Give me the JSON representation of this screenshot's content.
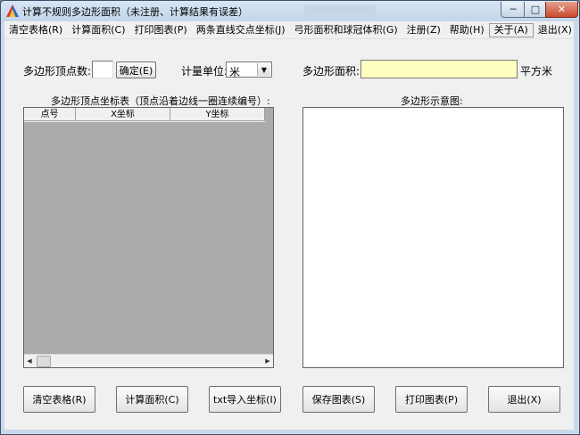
{
  "window": {
    "title": "计算不规则多边形面积（未注册、计算结果有误差）",
    "controls": {
      "minimize": "─",
      "maximize": "□",
      "close": "✕"
    }
  },
  "menu": [
    "清空表格(R)",
    "计算面积(C)",
    "打印图表(P)",
    "两条直线交点坐标(J)",
    "弓形面积和球冠体积(G)",
    "注册(Z)",
    "帮助(H)",
    "关于(A)",
    "退出(X)"
  ],
  "form": {
    "vertex_count_label": "多边形顶点数:",
    "vertex_count_value": "",
    "confirm_button": "确定(E)",
    "unit_label": "计量单位:",
    "unit_value": "米",
    "area_label": "多边形面积:",
    "area_value": "",
    "area_unit": "平方米"
  },
  "table": {
    "caption": "多边形顶点坐标表（顶点沿着边线一圈连续编号）:",
    "columns": [
      "点号",
      "X坐标",
      "Y坐标"
    ],
    "rows": []
  },
  "preview": {
    "caption": "多边形示意图:"
  },
  "buttons": {
    "clear": "清空表格(R)",
    "calculate": "计算面积(C)",
    "import": "txt导入坐标(I)",
    "save": "保存图表(S)",
    "print": "打印图表(P)",
    "exit": "退出(X)"
  },
  "icons": {
    "app": "triangle-app-icon",
    "dropdown": "chevron-down-icon",
    "scroll_left": "arrow-left-icon",
    "scroll_right": "arrow-right-icon"
  }
}
